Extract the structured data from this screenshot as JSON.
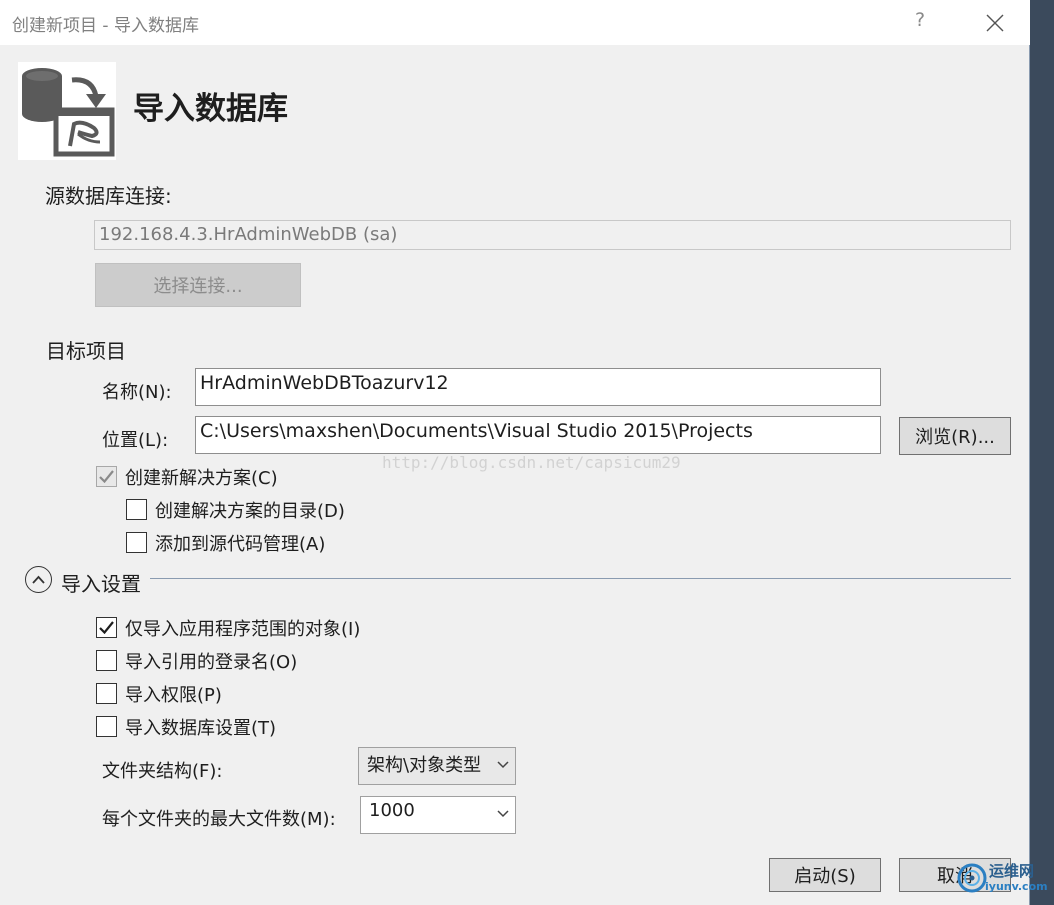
{
  "window": {
    "title": "创建新项目 - 导入数据库",
    "help_glyph": "?",
    "close_icon": "close-icon"
  },
  "header": {
    "heading": "导入数据库",
    "logo_icon": "database-import-icon"
  },
  "source": {
    "section_label": "源数据库连接:",
    "connection_value": "192.168.4.3.HrAdminWebDB (sa)",
    "select_connection_label": "选择连接..."
  },
  "target": {
    "section_label": "目标项目",
    "name_label": "名称(N):",
    "name_value": "HrAdminWebDBToazurv12",
    "location_label": "位置(L):",
    "location_value": "C:\\Users\\maxshen\\Documents\\Visual Studio 2015\\Projects",
    "browse_label": "浏览(R)...",
    "create_solution_label": "创建新解决方案(C)",
    "create_solution_checked": true,
    "create_directory_label": "创建解决方案的目录(D)",
    "create_directory_checked": false,
    "add_source_control_label": "添加到源代码管理(A)",
    "add_source_control_checked": false
  },
  "import_settings": {
    "section_label": "导入设置",
    "expanded": true,
    "options": [
      {
        "label": "仅导入应用程序范围的对象(I)",
        "checked": true
      },
      {
        "label": "导入引用的登录名(O)",
        "checked": false
      },
      {
        "label": "导入权限(P)",
        "checked": false
      },
      {
        "label": "导入数据库设置(T)",
        "checked": false
      }
    ],
    "folder_structure_label": "文件夹结构(F):",
    "folder_structure_value": "架构\\对象类型",
    "max_files_label": "每个文件夹的最大文件数(M):",
    "max_files_value": "1000"
  },
  "footer": {
    "start_label": "启动(S)",
    "cancel_label": "取消"
  },
  "overlays": {
    "watermark_text": "http://blog.csdn.net/capsicum29",
    "corner_logo_text": "运维网",
    "corner_logo_sub": "iyunv.com"
  },
  "colors": {
    "dialog_bg": "#f0f0f0",
    "desktop_bg": "#3b4a5c",
    "logo_gray": "#5a5a5a"
  }
}
